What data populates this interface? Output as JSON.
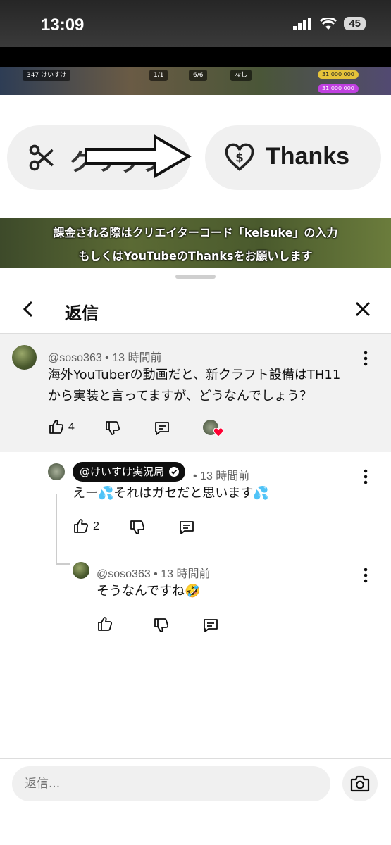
{
  "status_bar": {
    "time": "13:09",
    "battery": "45"
  },
  "video": {
    "clip_label": "クリップ",
    "thanks_label": "Thanks",
    "subtitle_line1": "課金される際はクリエイターコード「keisuke」の入力",
    "subtitle_line2": "もしくはYouTubeのThanksをお願いします",
    "hud_level": "347",
    "hud_name": "けいすけ",
    "hud_troops": "1/1",
    "hud_builders": "6/6",
    "hud_shield": "なし",
    "hud_gold": "31 000 000",
    "hud_elixir": "31 000 000"
  },
  "header": {
    "title": "返信"
  },
  "comments": [
    {
      "author": "@soso363",
      "time": "13 時間前",
      "text_line1": "海外YouTuberの動画だと、新クラフト設備はTH11",
      "text_line2": "から実装と言ってますが、どうなんでしょう？",
      "likes": "4"
    },
    {
      "author": "@けいすけ実況局",
      "time": "13 時間前",
      "text": "えー💦それはガセだと思います💦",
      "likes": "2"
    },
    {
      "author": "@soso363",
      "time": "13 時間前",
      "text": "そうなんですね🤣",
      "likes": ""
    }
  ],
  "composer": {
    "placeholder": "返信..."
  },
  "colors": {
    "accent_heart": "#ff0033",
    "highlight_bg": "#f2f2f2"
  }
}
